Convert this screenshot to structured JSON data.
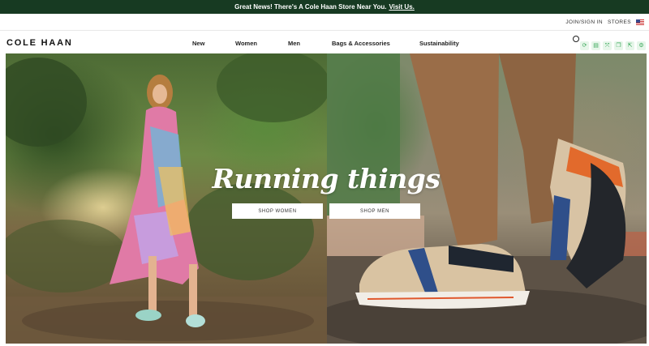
{
  "promo": {
    "message": "Great News! There's A Cole Haan Store Near You.",
    "link": "Visit Us."
  },
  "utility": {
    "join_signin": "JOIN/SIGN IN",
    "stores": "STORES"
  },
  "header": {
    "logo": "COLE HAAN",
    "nav": [
      "New",
      "Women",
      "Men",
      "Bags & Accessories",
      "Sustainability"
    ]
  },
  "hero": {
    "title": "Running things",
    "shop_women": "SHOP WOMEN",
    "shop_men": "SHOP MEN"
  },
  "colors": {
    "promo_bg": "#173a22",
    "toolbar_accent": "#3aa85a"
  }
}
